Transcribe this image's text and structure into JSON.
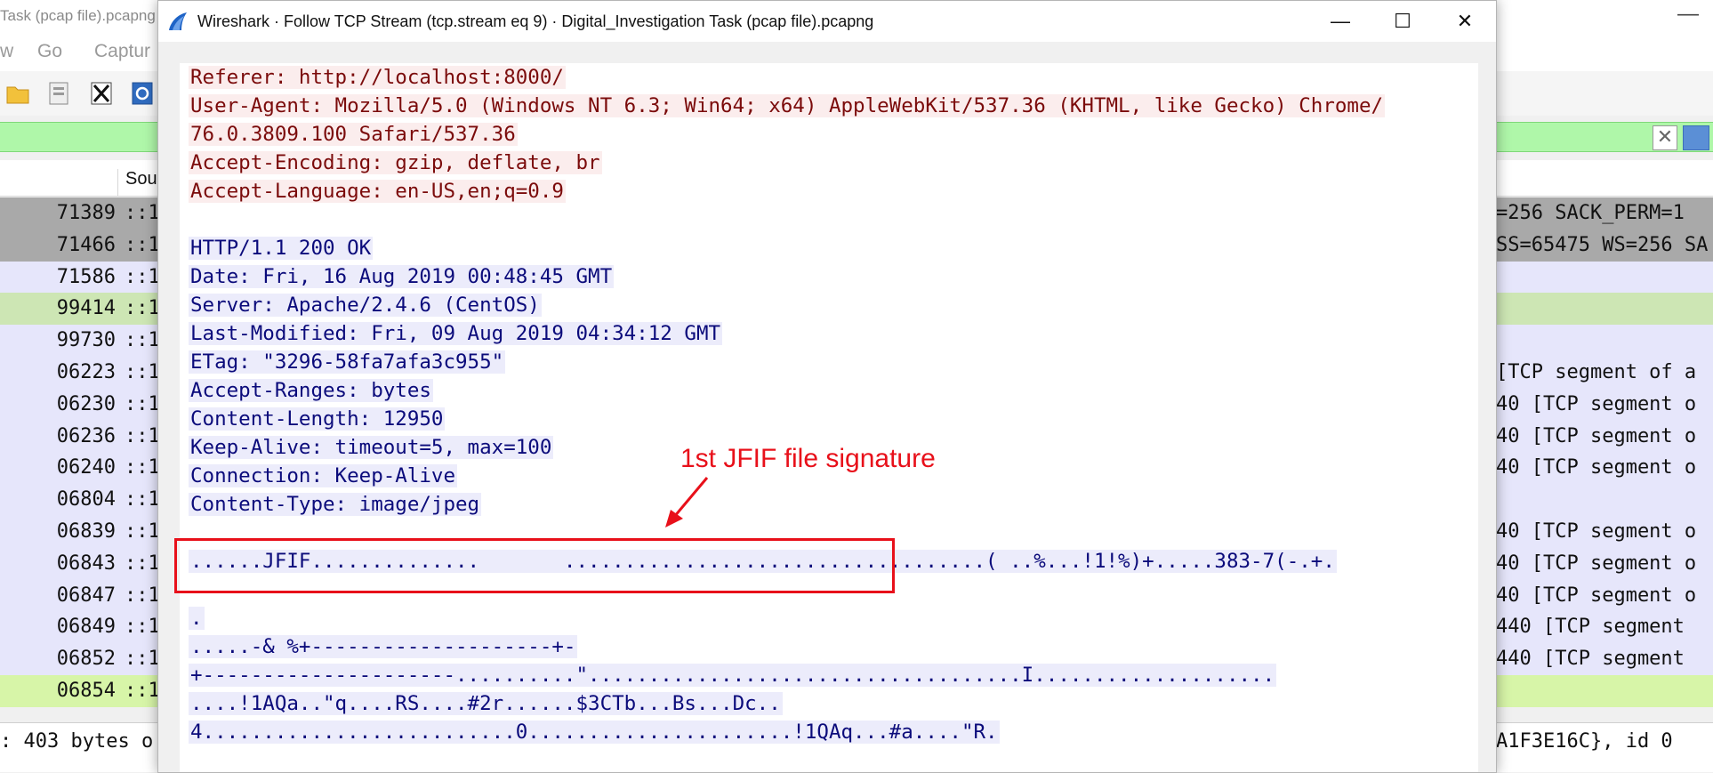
{
  "background": {
    "title": "Task (pcap file).pcapng",
    "menu": [
      "w",
      "Go",
      "Captur"
    ],
    "column_header": "Sou",
    "rows": [
      {
        "num": "71389",
        "src": "::1",
        "info": "=256 SACK_PERM=1",
        "color": "#a9a9a9"
      },
      {
        "num": "71466",
        "src": "::1",
        "info": "SS=65475 WS=256 SA",
        "color": "#a9a9a9"
      },
      {
        "num": "71586",
        "src": "::1",
        "info": "",
        "color": "#e6e6fb"
      },
      {
        "num": "99414",
        "src": "::1",
        "info": "",
        "color": "#cde6b4"
      },
      {
        "num": "99730",
        "src": "::1",
        "info": "",
        "color": "#e6e6fb"
      },
      {
        "num": "06223",
        "src": "::1",
        "info": "[TCP segment of a",
        "color": "#e6e6fb"
      },
      {
        "num": "06230",
        "src": "::1",
        "info": "40 [TCP segment o",
        "color": "#e6e6fb"
      },
      {
        "num": "06236",
        "src": "::1",
        "info": "40 [TCP segment o",
        "color": "#e6e6fb"
      },
      {
        "num": "06240",
        "src": "::1",
        "info": "40 [TCP segment o",
        "color": "#e6e6fb"
      },
      {
        "num": "06804",
        "src": "::1",
        "info": "",
        "color": "#e6e6fb"
      },
      {
        "num": "06839",
        "src": "::1",
        "info": "40 [TCP segment o",
        "color": "#e6e6fb"
      },
      {
        "num": "06843",
        "src": "::1",
        "info": "40 [TCP segment o",
        "color": "#e6e6fb"
      },
      {
        "num": "06847",
        "src": "::1",
        "info": "40 [TCP segment o",
        "color": "#e6e6fb"
      },
      {
        "num": "06849",
        "src": "::1",
        "info": "440 [TCP segment",
        "color": "#e6e6fb"
      },
      {
        "num": "06852",
        "src": "::1",
        "info": "440 [TCP segment",
        "color": "#e6e6fb"
      },
      {
        "num": "06854",
        "src": "::1",
        "info": "",
        "color": "#d7f5a8"
      }
    ],
    "status_left": ": 403 bytes o",
    "status_right": "A1F3E16C}, id 0"
  },
  "dialog": {
    "title": "Wireshark · Follow TCP Stream (tcp.stream eq 9) · Digital_Investigation Task (pcap file).pcapng",
    "min_symbol": "—",
    "max_symbol": "☐",
    "close_symbol": "✕"
  },
  "stream": {
    "client_lines": [
      "Referer: http://localhost:8000/",
      "User-Agent: Mozilla/5.0 (Windows NT 6.3; Win64; x64) AppleWebKit/537.36 (KHTML, like Gecko) Chrome/",
      "76.0.3809.100 Safari/537.36",
      "Accept-Encoding: gzip, deflate, br",
      "Accept-Language: en-US,en;q=0.9"
    ],
    "server_lines": [
      "HTTP/1.1 200 OK",
      "Date: Fri, 16 Aug 2019 00:48:45 GMT",
      "Server: Apache/2.4.6 (CentOS)",
      "Last-Modified: Fri, 09 Aug 2019 04:34:12 GMT",
      "ETag: \"3296-58fa7afa3c955\"",
      "Accept-Ranges: bytes",
      "Content-Length: 12950",
      "Keep-Alive: timeout=5, max=100",
      "Connection: Keep-Alive",
      "Content-Type: image/jpeg"
    ],
    "binary_lines": [
      "......JFIF..............       ...................................( ..%...!1!%)+.....383-7(-.+.",
      "",
      ".",
      ".....-& %+--------------------+-",
      "+---------------------..........\"....................................I....................",
      "....!1AQa..\"q....RS....#2r......$3CTb...Bs...Dc..",
      "4..........................0......................!1QAq...#a....\"R."
    ]
  },
  "annotation": {
    "label": "1st JFIF file signature",
    "color": "#e8101a"
  }
}
